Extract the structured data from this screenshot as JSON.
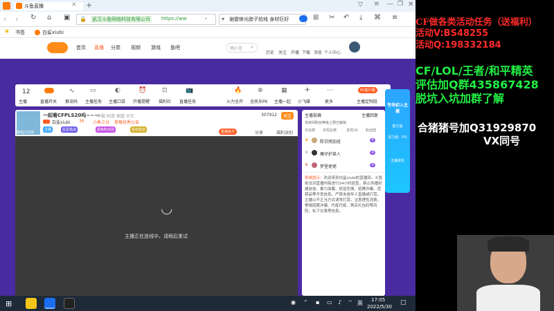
{
  "browser": {
    "tab_title": "斗鱼直播",
    "url_company": "武汉斗鱼网络科技有限公司",
    "url_text": "https://ww",
    "search_text": "谢霆锋光脖子拍戏 身材巨好",
    "bookmarks": [
      {
        "label": "书签"
      },
      {
        "label": "白鲨xiubi"
      }
    ]
  },
  "site_nav": {
    "items": [
      {
        "label": "首页"
      },
      {
        "label": "直播"
      },
      {
        "label": "分类"
      },
      {
        "label": "视频"
      },
      {
        "label": "游戏"
      },
      {
        "label": "鱼吧"
      }
    ],
    "search_placeholder": "明小言",
    "right_items": [
      {
        "label": "历史"
      },
      {
        "label": "关注"
      },
      {
        "label": "开播"
      },
      {
        "label": "下载"
      },
      {
        "label": "消息"
      },
      {
        "label": "个人中心"
      }
    ]
  },
  "toolbar": {
    "count": "12",
    "items": [
      {
        "label": "主播"
      },
      {
        "label": "直播开关"
      },
      {
        "label": "推流码"
      },
      {
        "label": "主播任务"
      },
      {
        "label": "主播口袋"
      },
      {
        "label": "开播提醒"
      },
      {
        "label": "福利社"
      },
      {
        "label": "直播任务"
      },
      {
        "label": "火力全开"
      },
      {
        "label": "全民乐PK"
      },
      {
        "label": "主播一起"
      },
      {
        "label": "小飞碟"
      },
      {
        "label": "更多"
      }
    ],
    "pc_badge": "PC客户端",
    "main_pc": "主播定制段"
  },
  "room": {
    "title": "一起看CFPLS20吗~~~",
    "tags": "举报  同游  穿越  卡王",
    "streamer": "白鲨xiubi",
    "level": "36",
    "guild": "小鱼三分",
    "guild2": "草莓优秀公会",
    "followers": "307912",
    "follow_btn": "关注",
    "heat": "虎牙",
    "rank_text": "直播官方",
    "share": "分享",
    "report": "福利派别",
    "thumb_caption": "离线/1分钟",
    "badges": [
      "主播",
      "星星挑战",
      "超级粉丝团",
      "钻石粉丝"
    ],
    "offline_msg": "主播正在连线中，请稍后重试"
  },
  "side_panel": {
    "tabs": [
      "主播投稿",
      "主播回复"
    ],
    "notice": "本房间粉丝等级上限已解锁",
    "sub_tabs": [
      "日总榜",
      "本周总榜",
      "贵宾(4)",
      "粉丝团"
    ],
    "users": [
      {
        "name": "陈甘雨加班"
      },
      {
        "name": "瘫仔护某人"
      },
      {
        "name": "梦里佬佬"
      }
    ],
    "sys_label": "系统提示：",
    "sys_msg": "欢迎来到白鲨xiubi的直播间。斗鱼依法对直播内容进行24小时巡查，禁止传播封建迷信、暴力血腥、低俗色情、招嫖诈骗、违禁品等不良信息。严禁未成年人直播或打赏。主播以不正当方式诱导打赏，注意理性消费。警惕招聘诈骗、代练代练、购买礼包码等风险，私下交易等信息。"
  },
  "right_promo": {
    "title": "专场初入主播",
    "item1": "能力值",
    "pct": "活力值：0%",
    "item2": "主播成长"
  },
  "overlay": {
    "line1": "CF做各类活动任务（送福利）",
    "line2": "活动V:BS48255",
    "line3": "活动Q:198332184",
    "line4": "CF/LOL/王者/和平精英",
    "line5": "评估加Q群435867428",
    "line6": "脱坑入坑加群了解",
    "line7": "合猪猪号加Q31929870",
    "line8": "VX同号"
  },
  "taskbar": {
    "time": "17:05",
    "date": "2022/5/30",
    "ime": "英"
  }
}
